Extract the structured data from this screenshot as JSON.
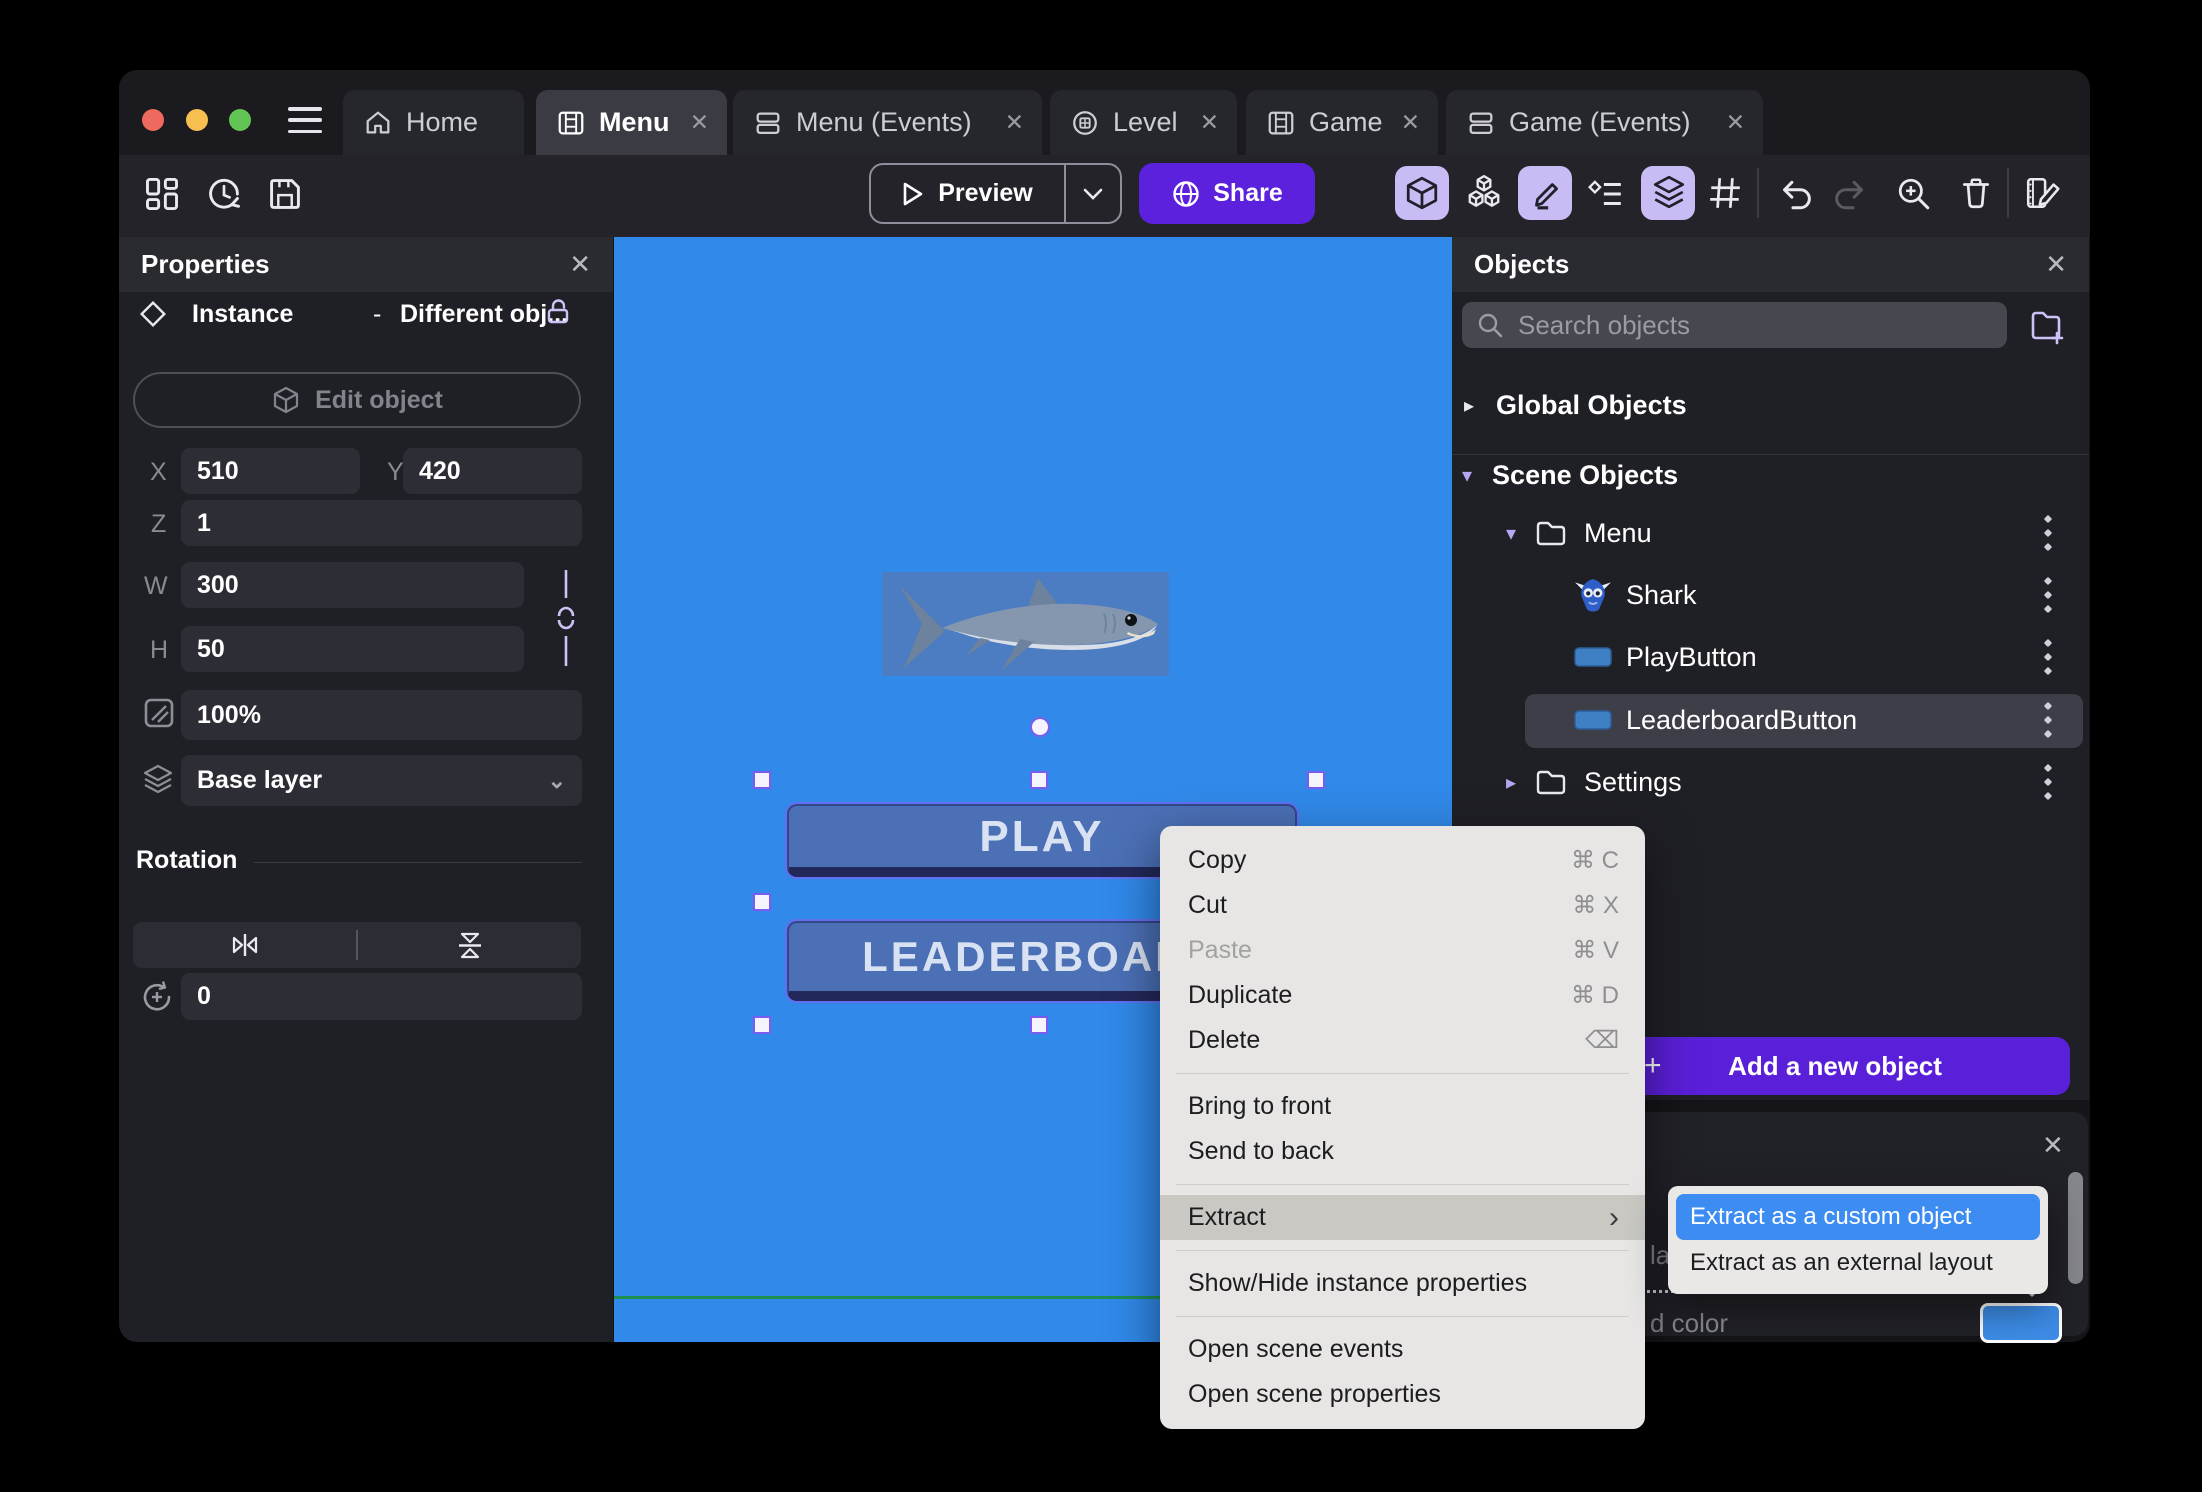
{
  "tabs": [
    {
      "label": "Home",
      "icon": "home",
      "closable": false,
      "active": false
    },
    {
      "label": "Menu",
      "icon": "scene",
      "closable": true,
      "active": true,
      "close": "✕"
    },
    {
      "label": "Menu (Events)",
      "icon": "events",
      "closable": true,
      "active": false,
      "close": "✕"
    },
    {
      "label": "Level",
      "icon": "layout",
      "closable": true,
      "active": false,
      "close": "✕"
    },
    {
      "label": "Game",
      "icon": "scene",
      "closable": true,
      "active": false,
      "close": "✕"
    },
    {
      "label": "Game (Events)",
      "icon": "events",
      "closable": true,
      "active": false,
      "close": "✕"
    }
  ],
  "toolbar": {
    "preview_label": "Preview",
    "share_label": "Share"
  },
  "properties": {
    "title": "Properties",
    "close": "✕",
    "instance_type": "Instance",
    "dash": "-",
    "instance_object": "Different obj...",
    "edit_object_label": "Edit object",
    "x_label": "X",
    "x_value": "510",
    "y_label": "Y",
    "y_value": "420",
    "z_label": "Z",
    "z_value": "1",
    "w_label": "W",
    "w_value": "300",
    "h_label": "H",
    "h_value": "50",
    "opacity_value": "100%",
    "layer_value": "Base layer",
    "layer_chevron": "⌄",
    "rotation_title": "Rotation",
    "rotation_value": "0"
  },
  "canvas": {
    "play_label": "PLAY",
    "leaderboard_label": "LEADERBOARD",
    "background_color": "#3189e9",
    "button_color": "#4b70b6",
    "selection_color": "#7b5cf0",
    "scene_line_color": "#1c9150"
  },
  "objects_panel": {
    "title": "Objects",
    "close": "✕",
    "search_placeholder": "Search objects",
    "global_label": "Global Objects",
    "global_caret": "▸",
    "scene_label": "Scene Objects",
    "scene_caret": "▾",
    "tree": [
      {
        "name": "Menu",
        "caret": "▾"
      },
      {
        "name": "Shark"
      },
      {
        "name": "PlayButton"
      },
      {
        "name": "LeaderboardButton",
        "selected": true
      },
      {
        "name": "Settings",
        "caret": "▸"
      }
    ],
    "add_button_label": "Add a new object",
    "add_button_plus": "+"
  },
  "context_menu": {
    "items": [
      {
        "label": "Copy",
        "shortcut": "⌘ C"
      },
      {
        "label": "Cut",
        "shortcut": "⌘ X"
      },
      {
        "label": "Paste",
        "shortcut": "⌘ V",
        "disabled": true
      },
      {
        "label": "Duplicate",
        "shortcut": "⌘ D"
      },
      {
        "label": "Delete",
        "shortcut": "⌫"
      },
      {
        "label": "Bring to front"
      },
      {
        "label": "Send to back"
      },
      {
        "label": "Extract",
        "chevron": "›",
        "highlighted": true
      },
      {
        "label": "Show/Hide instance properties"
      },
      {
        "label": "Open scene events"
      },
      {
        "label": "Open scene properties"
      }
    ]
  },
  "submenu": {
    "items": [
      {
        "label": "Extract as a custom object",
        "selected": true
      },
      {
        "label": "Extract as an external layout"
      }
    ],
    "highlight_color": "#3d8cf2"
  },
  "layers_panel": {
    "close": "✕",
    "layer_text_fragment": "layer",
    "color_text_fragment": "d color"
  },
  "colors": {
    "accent_purple": "#5b21dc",
    "add_button_purple": "#5a1fd8",
    "active_tool_bg": "#c9bcf4"
  }
}
